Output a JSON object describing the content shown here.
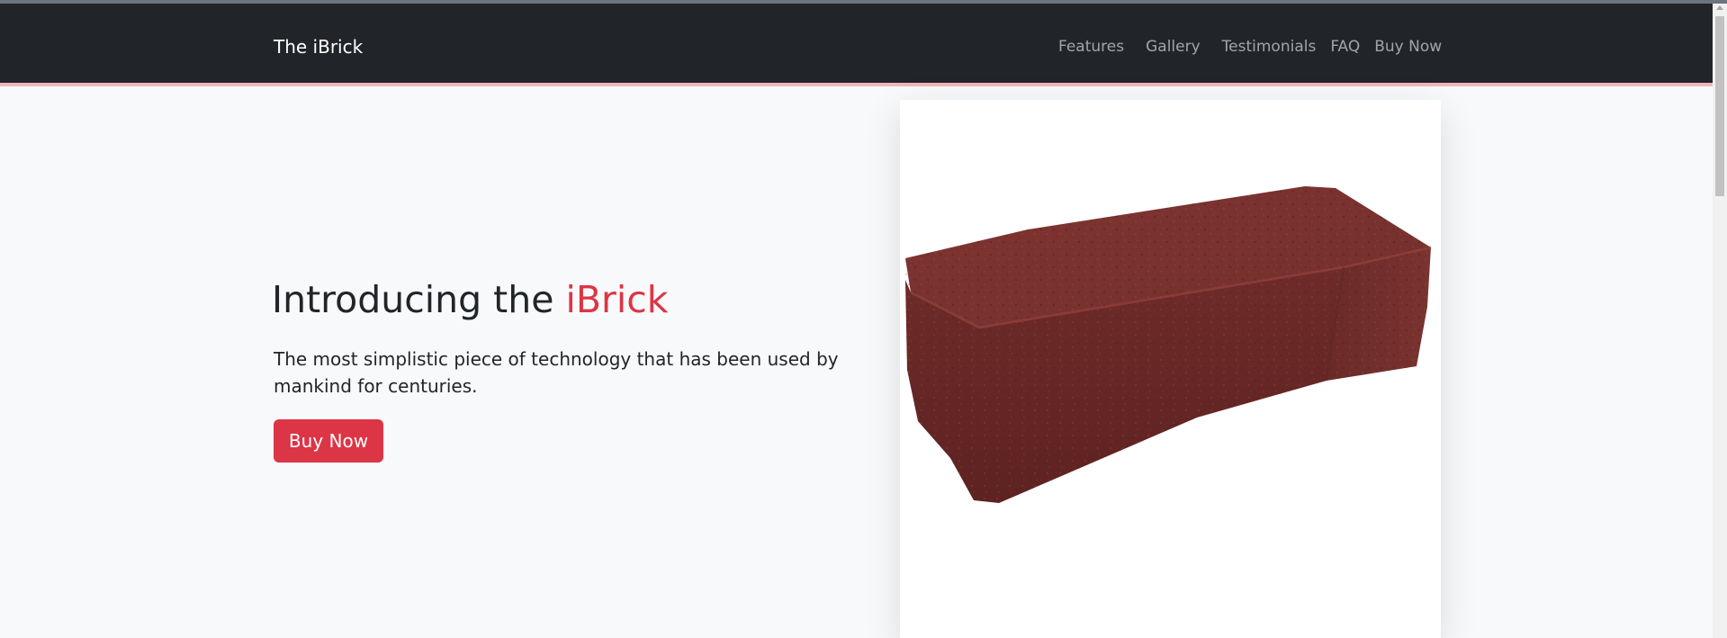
{
  "navbar": {
    "brand": "The iBrick",
    "links": [
      "Features",
      "Gallery",
      "Testimonials",
      "FAQ",
      "Buy Now"
    ]
  },
  "hero": {
    "title_prefix": "Introducing the ",
    "title_accent": "iBrick",
    "lead": "The most simplistic piece of technology that has been used by mankind for centuries.",
    "cta_label": "Buy Now"
  },
  "colors": {
    "navbar_bg": "#212529",
    "accent": "#dc3545",
    "page_bg": "#f8f9fa",
    "brick": "#7a2f2c"
  },
  "icons": {
    "product_image": "red-brick-image"
  }
}
